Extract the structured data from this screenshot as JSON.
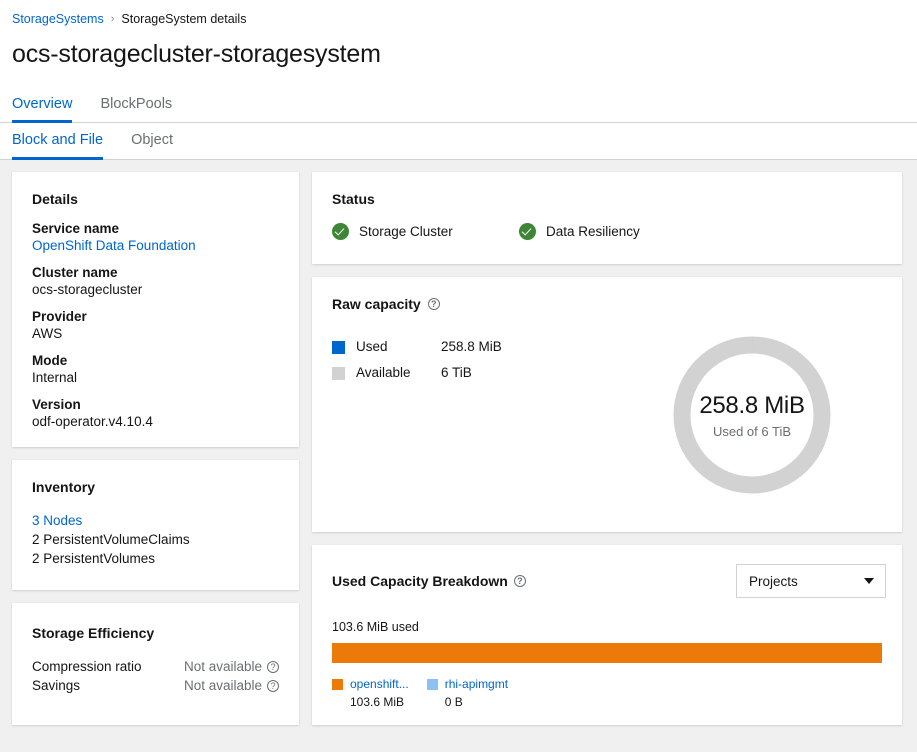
{
  "breadcrumb": {
    "root_label": "StorageSystems",
    "separator": "›",
    "current_label": "StorageSystem details"
  },
  "page": {
    "title": "ocs-storagecluster-storagesystem"
  },
  "tabs_primary": [
    {
      "label": "Overview",
      "active": true
    },
    {
      "label": "BlockPools",
      "active": false
    }
  ],
  "tabs_secondary": [
    {
      "label": "Block and File",
      "active": true
    },
    {
      "label": "Object",
      "active": false
    }
  ],
  "details_card": {
    "title": "Details",
    "items": [
      {
        "term": "Service name",
        "value": "OpenShift Data Foundation",
        "is_link": true
      },
      {
        "term": "Cluster name",
        "value": "ocs-storagecluster",
        "is_link": false
      },
      {
        "term": "Provider",
        "value": "AWS",
        "is_link": false
      },
      {
        "term": "Mode",
        "value": "Internal",
        "is_link": false
      },
      {
        "term": "Version",
        "value": "odf-operator.v4.10.4",
        "is_link": false
      }
    ]
  },
  "inventory_card": {
    "title": "Inventory",
    "items": [
      {
        "label": "3 Nodes",
        "is_link": true
      },
      {
        "label": "2 PersistentVolumeClaims",
        "is_link": false
      },
      {
        "label": "2 PersistentVolumes",
        "is_link": false
      }
    ]
  },
  "storage_efficiency_card": {
    "title": "Storage Efficiency",
    "rows": [
      {
        "label": "Compression ratio",
        "value": "Not available",
        "help_icon": "help-circle-icon"
      },
      {
        "label": "Savings",
        "value": "Not available",
        "help_icon": "help-circle-icon"
      }
    ]
  },
  "status_card": {
    "title": "Status",
    "items": [
      {
        "label": "Storage Cluster",
        "state": "ok",
        "icon": "check-circle-icon"
      },
      {
        "label": "Data Resiliency",
        "state": "ok",
        "icon": "check-circle-icon"
      }
    ]
  },
  "raw_capacity_card": {
    "title": "Raw capacity",
    "help_icon": "help-circle-icon",
    "legend": [
      {
        "name": "Used",
        "value": "258.8 MiB",
        "color": "#0066cc"
      },
      {
        "name": "Available",
        "value": "6 TiB",
        "color": "#d2d2d2"
      }
    ],
    "donut": {
      "primary": "258.8 MiB",
      "secondary": "Used of 6 TiB",
      "used_fraction": 4e-05,
      "used_color": "#0066cc",
      "track_color": "#d2d2d2"
    }
  },
  "used_capacity_card": {
    "title": "Used Capacity Breakdown",
    "help_icon": "help-circle-icon",
    "selector": {
      "value": "Projects",
      "icon": "chevron-down-icon"
    },
    "used_total_label": "103.6 MiB used",
    "segments": [
      {
        "name": "openshift...",
        "value": "103.6 MiB",
        "color": "#ec7a08",
        "percent": 100
      },
      {
        "name": "rhi-apimgmt",
        "value": "0 B",
        "color": "#8bc1f7",
        "percent": 0
      }
    ]
  },
  "chart_data": [
    {
      "type": "pie",
      "title": "Raw capacity",
      "labels": [
        "Used",
        "Available"
      ],
      "values": [
        0.2528,
        6144
      ],
      "unit": "GiB",
      "display_values": [
        "258.8 MiB",
        "6 TiB"
      ],
      "colors": [
        "#0066cc",
        "#d2d2d2"
      ],
      "center_primary": "258.8 MiB",
      "center_secondary": "Used of 6 TiB",
      "legend": "left"
    },
    {
      "type": "bar",
      "title": "Used Capacity Breakdown",
      "orientation": "horizontal-stacked",
      "categories": [
        "openshift...",
        "rhi-apimgmt"
      ],
      "values": [
        103.6,
        0
      ],
      "unit": "MiB",
      "display_values": [
        "103.6 MiB",
        "0 B"
      ],
      "colors": [
        "#ec7a08",
        "#8bc1f7"
      ],
      "total_label": "103.6 MiB used",
      "legend": "bottom",
      "grid": false
    }
  ]
}
